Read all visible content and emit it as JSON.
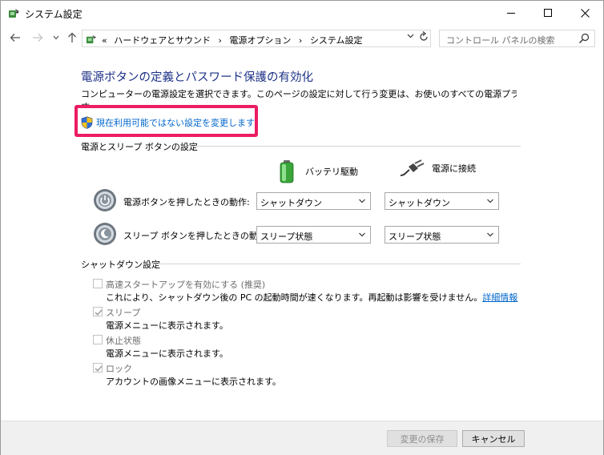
{
  "window": {
    "title": "システム設定"
  },
  "address": {
    "overflow": "«",
    "crumbs": [
      "ハードウェアとサウンド",
      "電源オプション",
      "システム設定"
    ],
    "separator": "›",
    "search_placeholder": "コントロール パネルの検索"
  },
  "page": {
    "title": "電源ボタンの定義とパスワード保護の有効化",
    "description": "コンピューターの電源設定を選択できます。このページの設定に対して行う変更は、お使いのすべての電源プランに適用されま",
    "description_cont": "す。",
    "change_link": "現在利用可能ではない設定を変更します"
  },
  "buttons_section": {
    "title": "電源とスリープ ボタンの設定",
    "battery_header": "バッテリ駆動",
    "plugged_header": "電源に接続",
    "rows": [
      {
        "label": "電源ボタンを押したときの動作:",
        "battery": "シャットダウン",
        "plugged": "シャットダウン"
      },
      {
        "label": "スリープ ボタンを押したときの動作:",
        "battery": "スリープ状態",
        "plugged": "スリープ状態"
      }
    ]
  },
  "shutdown_section": {
    "title": "シャットダウン設定",
    "options": [
      {
        "label": "高速スタートアップを有効にする (推奨)",
        "checked": false,
        "desc": "これにより、シャットダウン後の PC の起動時間が速くなります。再起動は影響を受けません。",
        "link": "詳細情報"
      },
      {
        "label": "スリープ",
        "checked": true,
        "desc": "電源メニューに表示されます。"
      },
      {
        "label": "休止状態",
        "checked": false,
        "desc": "電源メニューに表示されます。"
      },
      {
        "label": "ロック",
        "checked": true,
        "desc": "アカウントの画像メニューに表示されます。"
      }
    ]
  },
  "footer": {
    "save_label": "変更の保存",
    "cancel_label": "キャンセル"
  },
  "colors": {
    "title_blue": "#1e3287",
    "link_blue": "#0066cc",
    "highlight_pink": "#ec1c64"
  }
}
